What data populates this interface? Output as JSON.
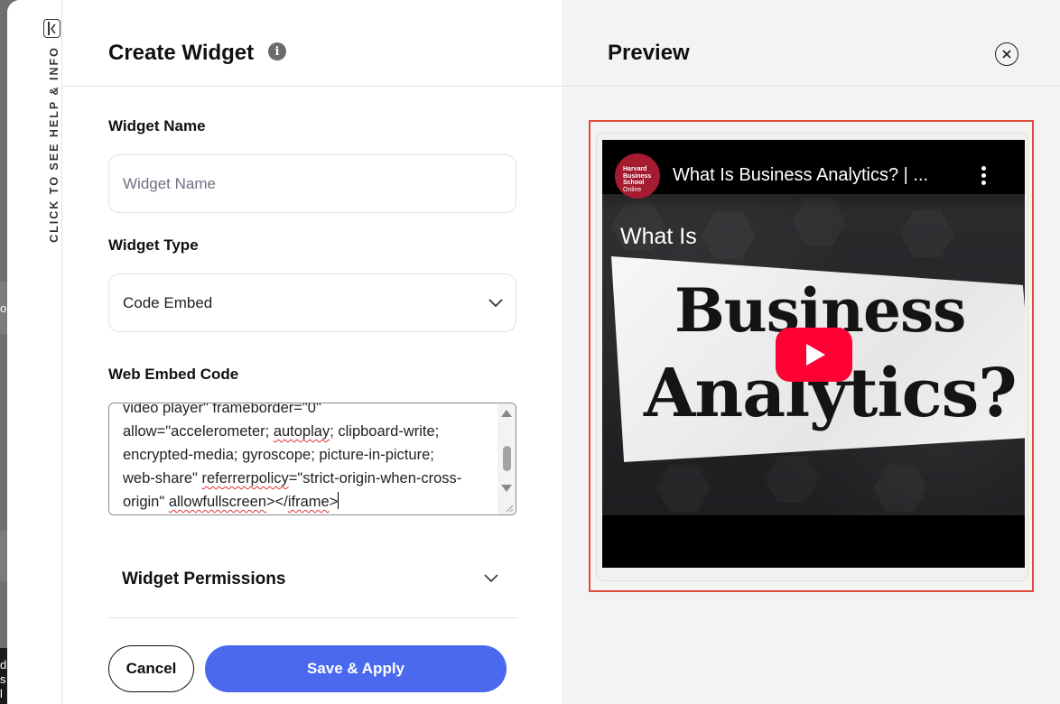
{
  "backdrop": {
    "frag1": "o",
    "frag2": "d",
    "frag3": "s",
    "frag4": "l"
  },
  "help_rail": {
    "label": "CLICK TO SEE HELP & INFO"
  },
  "form": {
    "title": "Create Widget",
    "info_icon_glyph": "i",
    "widget_name": {
      "label": "Widget Name",
      "placeholder": "Widget Name",
      "value": ""
    },
    "widget_type": {
      "label": "Widget Type",
      "selected": "Code Embed"
    },
    "embed_code": {
      "label": "Web Embed Code",
      "lines": [
        "video player\" frameborder=\"0\"",
        "allow=\"accelerometer; ",
        "autoplay",
        "; clipboard-write;",
        "encrypted-media; gyroscope; picture-in-picture;",
        "web-share\" ",
        "referrerpolicy",
        "=\"strict-origin-when-cross-",
        "origin\" ",
        "allowfullscreen",
        "></",
        "iframe",
        ">"
      ]
    },
    "permissions": {
      "label": "Widget Permissions"
    },
    "buttons": {
      "cancel": "Cancel",
      "save": "Save & Apply"
    }
  },
  "preview": {
    "title": "Preview",
    "video": {
      "channel_logo_lines": [
        "Harvard",
        "Business",
        "School",
        "Online"
      ],
      "title": "What Is Business Analytics? | ...",
      "overlay_small": "What Is",
      "overlay_big_1": "Business",
      "overlay_big_2": "Analytics?"
    }
  },
  "colors": {
    "accent_button": "#4a69ee",
    "highlight_border": "#e14b3b",
    "youtube_red": "#ff0033",
    "channel_red": "#a51c30"
  },
  "icons": {
    "rail_toggle": "collapse-panel-icon",
    "info": "info-icon",
    "dropdown": "chevron-down-icon",
    "close": "close-icon",
    "play": "play-icon",
    "menu": "more-vert-icon"
  }
}
